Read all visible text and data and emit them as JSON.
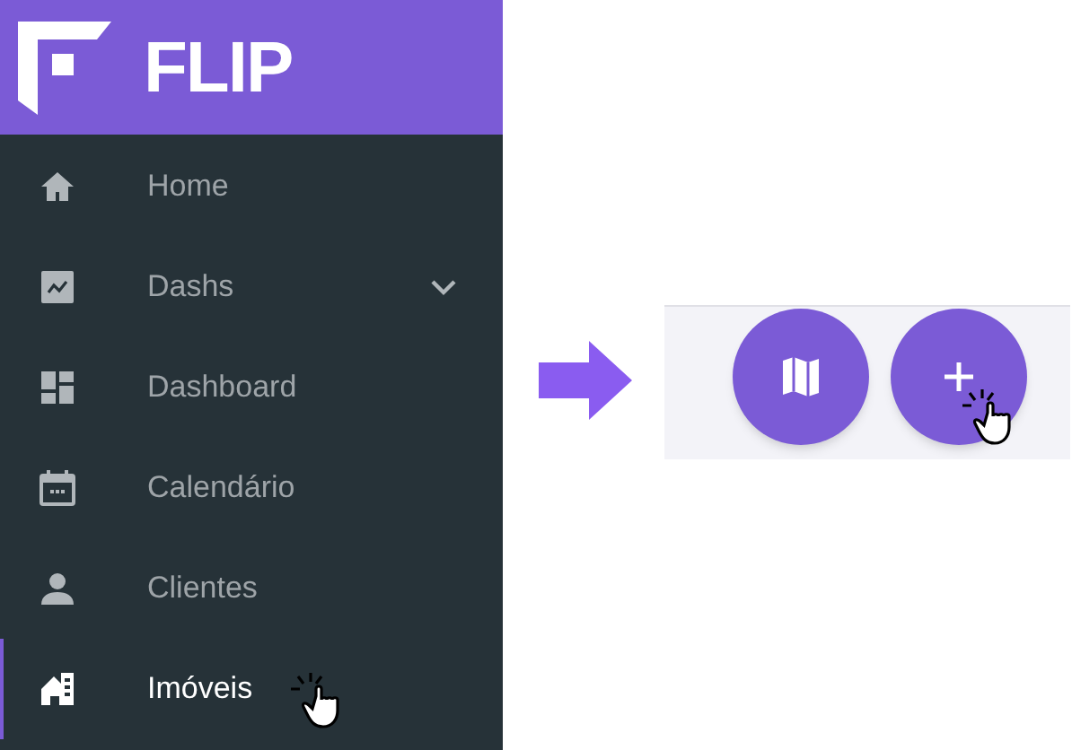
{
  "sidebar": {
    "brand": "FLIP",
    "items": [
      {
        "label": "Home",
        "kind": "link",
        "selected": false
      },
      {
        "label": "Dashs",
        "kind": "group",
        "selected": false
      },
      {
        "label": "Dashboard",
        "kind": "link",
        "selected": false
      },
      {
        "label": "Calendário",
        "kind": "link",
        "selected": false
      },
      {
        "label": "Clientes",
        "kind": "link",
        "selected": false
      },
      {
        "label": "Imóveis",
        "kind": "link",
        "selected": true
      }
    ]
  },
  "action_buttons": [
    {
      "kind": "map"
    },
    {
      "kind": "add"
    }
  ]
}
